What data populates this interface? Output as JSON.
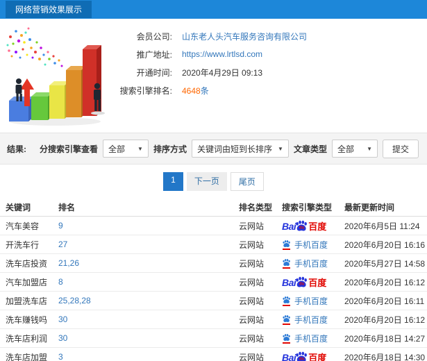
{
  "header": {
    "title": "网络营销效果展示"
  },
  "info": {
    "rows": [
      {
        "label": "会员公司:",
        "value": "山东老人头汽车服务咨询有限公司"
      },
      {
        "label": "推广地址:",
        "value": "https://www.lrtlsd.com"
      },
      {
        "label": "开通时间:",
        "value": "2020年4月29日 09:13"
      },
      {
        "label": "搜索引擎排名:",
        "value_number": "4648",
        "value_unit": "条"
      }
    ]
  },
  "filters": {
    "result_label": "结果:",
    "engine_label": "分搜索引擎查看",
    "engine_value": "全部",
    "sort_label": "排序方式",
    "sort_value": "关键词由短到长排序",
    "type_label": "文章类型",
    "type_value": "全部",
    "submit_label": "提交"
  },
  "pagination": {
    "current": "1",
    "next": "下一页",
    "last": "尾页"
  },
  "logos": {
    "baidu_bai": "Bai",
    "baidu_du": "du",
    "baidu_cn": "百度",
    "mobile_label": "手机百度"
  },
  "table": {
    "headers": [
      "关键词",
      "排名",
      "排名类型",
      "搜索引擎类型",
      "最新更新时间"
    ],
    "rows": [
      {
        "keyword": "汽车美容",
        "rank": "9",
        "rank_type": "云网站",
        "engine": "baidu",
        "time": "2020年6月5日 11:24"
      },
      {
        "keyword": "开洗车行",
        "rank": "27",
        "rank_type": "云网站",
        "engine": "mobile",
        "time": "2020年6月20日 16:16"
      },
      {
        "keyword": "洗车店投资",
        "rank": "21,26",
        "rank_type": "云网站",
        "engine": "mobile",
        "time": "2020年5月27日 14:58"
      },
      {
        "keyword": "汽车加盟店",
        "rank": "8",
        "rank_type": "云网站",
        "engine": "baidu",
        "time": "2020年6月20日 16:12"
      },
      {
        "keyword": "加盟洗车店",
        "rank": "25,28,28",
        "rank_type": "云网站",
        "engine": "mobile",
        "time": "2020年6月20日 16:11"
      },
      {
        "keyword": "洗车赚钱吗",
        "rank": "30",
        "rank_type": "云网站",
        "engine": "mobile",
        "time": "2020年6月20日 16:12"
      },
      {
        "keyword": "洗车店利润",
        "rank": "30",
        "rank_type": "云网站",
        "engine": "mobile",
        "time": "2020年6月18日 14:27"
      },
      {
        "keyword": "洗车店加盟",
        "rank": "3",
        "rank_type": "云网站",
        "engine": "baidu",
        "time": "2020年6月18日 14:30"
      }
    ]
  },
  "colors": {
    "header_bar": "#1d87d9",
    "header_tab": "#0f6cb4",
    "link_blue": "#3377bb",
    "count_orange": "#ff6600",
    "baidu_blue": "#2534dc",
    "baidu_red": "#e10601",
    "pagination_active": "#2277c8"
  }
}
